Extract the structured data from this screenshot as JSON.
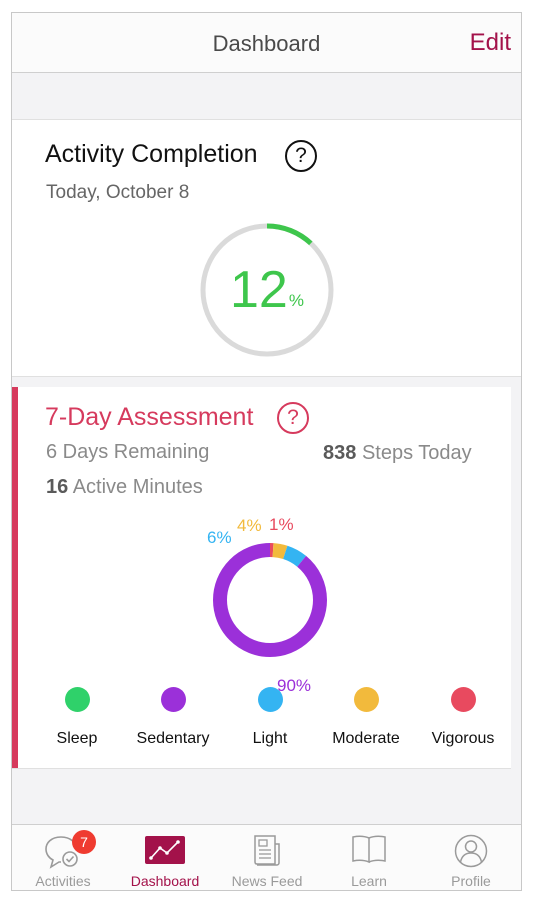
{
  "nav": {
    "title": "Dashboard",
    "edit_label": "Edit"
  },
  "activity": {
    "title": "Activity Completion",
    "help": "?",
    "date": "Today, October 8",
    "percent": "12",
    "percent_unit": "%",
    "progress_fraction": 0.12,
    "ring_color": "#3ec64c"
  },
  "assessment": {
    "title": "7-Day Assessment",
    "help": "?",
    "days_remaining": "6 Days Remaining",
    "steps_value": "838",
    "steps_label": "Steps Today",
    "active_value": "16",
    "active_label": "Active Minutes",
    "accent_color": "#d63a5d",
    "breakdown": [
      {
        "label": "90%",
        "value": 90,
        "color": "#9b30d9"
      },
      {
        "label": "6%",
        "value": 6,
        "color": "#34b4f2"
      },
      {
        "label": "4%",
        "value": 4,
        "color": "#f2ba3c"
      },
      {
        "label": "1%",
        "value": 1,
        "color": "#e84a5f"
      }
    ],
    "legend": [
      {
        "label": "Sleep",
        "color": "#2fd16a"
      },
      {
        "label": "Sedentary",
        "color": "#9b30d9"
      },
      {
        "label": "Light",
        "color": "#34b4f2"
      },
      {
        "label": "Moderate",
        "color": "#f2ba3c"
      },
      {
        "label": "Vigorous",
        "color": "#e84a5f"
      }
    ]
  },
  "tabs": [
    {
      "label": "Activities",
      "icon": "chat-check-icon",
      "badge": "7"
    },
    {
      "label": "Dashboard",
      "icon": "chart-icon",
      "active": true
    },
    {
      "label": "News Feed",
      "icon": "newspaper-icon"
    },
    {
      "label": "Learn",
      "icon": "book-icon"
    },
    {
      "label": "Profile",
      "icon": "person-icon"
    }
  ],
  "colors": {
    "brand": "#a3124a"
  }
}
